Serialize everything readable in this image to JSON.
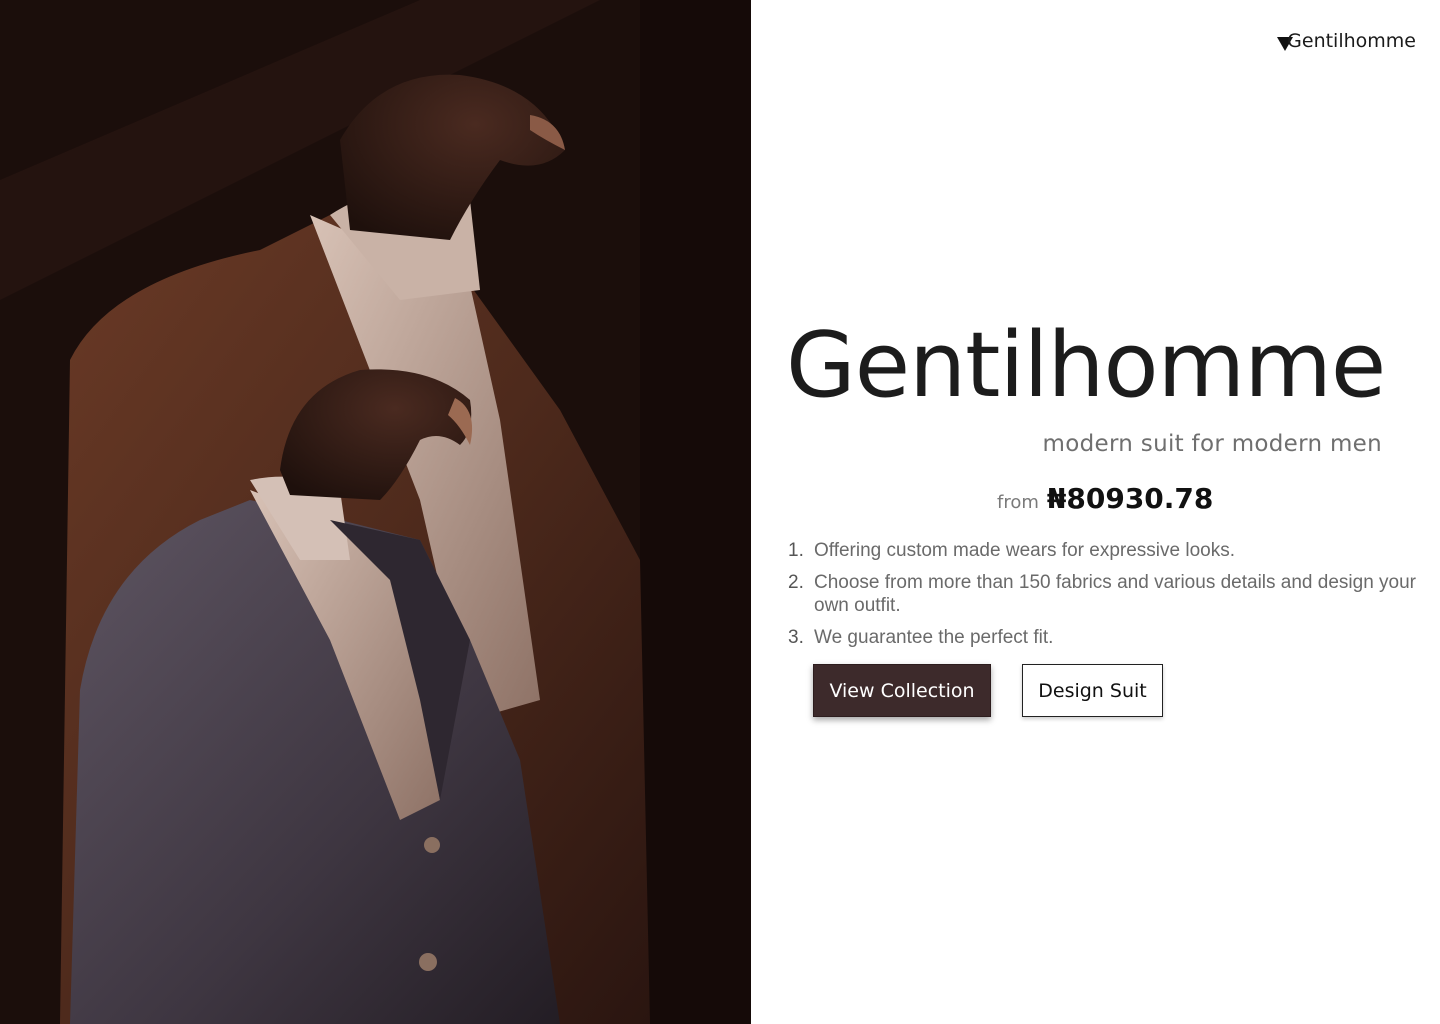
{
  "header": {
    "brand_label": "Gentilhomme",
    "menu_icon": "caret-down-icon"
  },
  "hero": {
    "title": "Gentilhomme",
    "tagline": "modern suit for modern men",
    "image_description_icon": "suit-mannequins-image"
  },
  "pricing": {
    "from_label": "from",
    "price": "₦80930.78"
  },
  "features": [
    {
      "number": "1.",
      "text": "Offering custom made wears for expressive looks."
    },
    {
      "number": "2.",
      "text": "Choose from more than 150 fabrics and various details and design your own outfit."
    },
    {
      "number": "3.",
      "text": "We guarantee the perfect fit."
    }
  ],
  "actions": {
    "view_collection_label": "View Collection",
    "design_suit_label": "Design Suit"
  },
  "colors": {
    "primary_button_bg": "#3d2a2b",
    "text_dark": "#1c1c1c",
    "text_muted": "#6f6f6f"
  }
}
